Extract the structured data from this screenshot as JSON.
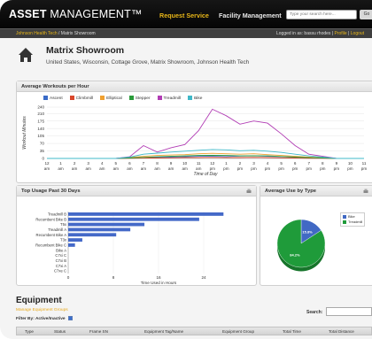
{
  "app": {
    "logo_bold": "ASSET",
    "logo_rest": " MANAGEMENT™",
    "nav": [
      "Request Service",
      "Facility Management"
    ],
    "search_placeholder": "Type your search here...",
    "go_label": "Go"
  },
  "breadcrumb": {
    "root": "Johnson Health Tech",
    "separator": " / ",
    "current": "Matrix Showroom"
  },
  "login": {
    "text": "Logged in as: bassu rhodes | ",
    "profile": "Profile",
    "separator": " | ",
    "logout": "Logout"
  },
  "header": {
    "title": "Matrix Showroom",
    "subtitle": "United States, Wisconsin, Cottage Grove, Matrix Showroom, Johnson Health Tech"
  },
  "workouts_panel": {
    "title": "Average Workouts per Hour"
  },
  "usage_panel": {
    "title": "Top Usage Past 30 Days"
  },
  "type_panel": {
    "title": "Average Use by Type"
  },
  "colors": {
    "gold": "#e8b618",
    "ascent": "#3a6bc7",
    "climbmill": "#d9472b",
    "elliptical": "#f0a030",
    "stepper": "#2a9b3a",
    "treadmill": "#b13cb4",
    "bike": "#3fb8c8",
    "bar": "#4469c8",
    "pie_green": "#1f9b3a",
    "pie_blue": "#4169c4"
  },
  "chart_data": [
    {
      "type": "line",
      "title": "Average Workouts per Hour",
      "xlabel": "Time of Day",
      "ylabel": "Workout Minutes",
      "ylim": [
        0,
        240
      ],
      "yticks": [
        0,
        35,
        70,
        105,
        140,
        175,
        210,
        240
      ],
      "x_top": [
        "12",
        "1",
        "2",
        "3",
        "4",
        "5",
        "6",
        "7",
        "8",
        "9",
        "10",
        "11",
        "12",
        "1",
        "2",
        "3",
        "4",
        "5",
        "6",
        "7",
        "8",
        "9",
        "10",
        "11"
      ],
      "x_bottom": [
        "am",
        "am",
        "am",
        "am",
        "am",
        "am",
        "am",
        "am",
        "am",
        "am",
        "am",
        "am",
        "pm",
        "pm",
        "pm",
        "pm",
        "pm",
        "pm",
        "pm",
        "pm",
        "pm",
        "pm",
        "pm",
        "pm"
      ],
      "series": [
        {
          "name": "Ascent",
          "color": "#3a6bc7",
          "values": [
            0,
            0,
            0,
            0,
            0,
            0,
            2,
            4,
            5,
            6,
            8,
            10,
            10,
            9,
            11,
            12,
            10,
            8,
            6,
            4,
            2,
            0,
            0,
            0
          ]
        },
        {
          "name": "Climbmill",
          "color": "#d9472b",
          "values": [
            0,
            0,
            0,
            0,
            0,
            0,
            1,
            2,
            2,
            3,
            4,
            4,
            5,
            4,
            4,
            5,
            4,
            3,
            2,
            1,
            1,
            0,
            0,
            0
          ]
        },
        {
          "name": "Elliptical",
          "color": "#f0a030",
          "values": [
            0,
            0,
            0,
            0,
            0,
            0,
            4,
            10,
            14,
            16,
            18,
            22,
            24,
            22,
            20,
            22,
            18,
            14,
            10,
            6,
            3,
            0,
            0,
            0
          ]
        },
        {
          "name": "Stepper",
          "color": "#2a9b3a",
          "values": [
            0,
            0,
            0,
            0,
            0,
            0,
            2,
            5,
            8,
            10,
            12,
            14,
            15,
            14,
            12,
            13,
            12,
            9,
            6,
            4,
            2,
            0,
            0,
            0
          ]
        },
        {
          "name": "Treadmill",
          "color": "#b13cb4",
          "values": [
            0,
            0,
            0,
            0,
            0,
            0,
            8,
            60,
            30,
            50,
            65,
            130,
            230,
            200,
            160,
            175,
            165,
            115,
            60,
            20,
            10,
            0,
            0,
            0
          ]
        },
        {
          "name": "Bike",
          "color": "#3fb8c8",
          "values": [
            0,
            0,
            0,
            0,
            0,
            0,
            6,
            20,
            25,
            30,
            34,
            38,
            42,
            40,
            36,
            38,
            34,
            28,
            20,
            12,
            6,
            0,
            0,
            0
          ]
        }
      ]
    },
    {
      "type": "bar",
      "orientation": "horizontal",
      "title": "Top Usage Past 30 Days",
      "xlabel": "Time Used in Hours",
      "xlim": [
        0,
        32
      ],
      "xticks": [
        0,
        8,
        16,
        24
      ],
      "categories": [
        "Treadmill B",
        "Recumbent Bike B",
        "T5x",
        "Treadmill A",
        "Recumbent Bike A",
        "T3x",
        "Recumbent Bike C",
        "Bike A",
        "C7xi C",
        "C7xi B",
        "C7xi A",
        "C7xe C"
      ],
      "values": [
        27.5,
        23.2,
        13.5,
        11.0,
        8.5,
        2.5,
        1.2,
        0,
        0,
        0,
        0,
        0
      ]
    },
    {
      "type": "pie",
      "title": "Average Use by Type",
      "categories": [
        "Bike",
        "Treadmill"
      ],
      "values": [
        15.8,
        84.2
      ],
      "labels": [
        "15.8%",
        "84.2%"
      ],
      "colors": [
        "#4169c4",
        "#1f9b3a"
      ]
    }
  ],
  "equipment": {
    "title": "Equipment",
    "manage_link": "Manage Equipment Groups",
    "filter_label": "Filter By: Active/Inactive",
    "search_label": "Search:",
    "columns": [
      "Type",
      "Status",
      "Frame SN",
      "Equipment Tag/Name",
      "Equipment Group",
      "Total Time",
      "Total Distance"
    ]
  }
}
